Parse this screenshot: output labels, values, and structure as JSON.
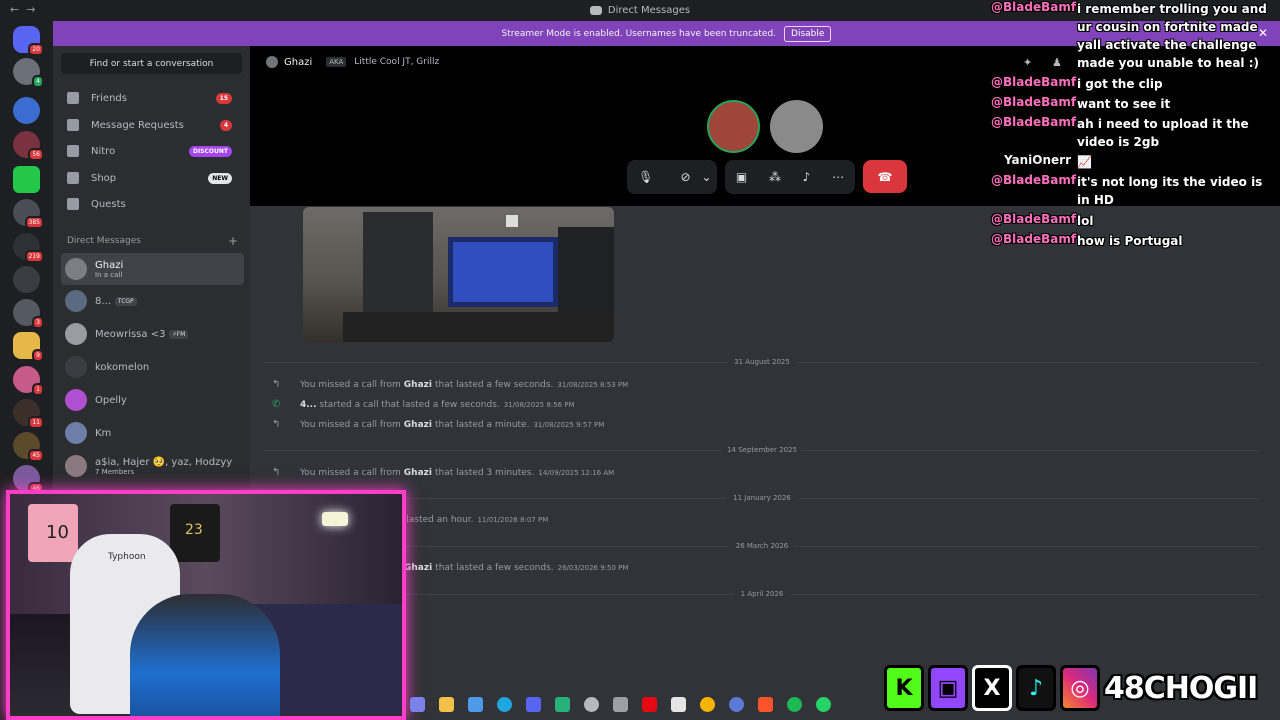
{
  "titlebar": {
    "title": "Direct Messages"
  },
  "banner": {
    "text": "Streamer Mode is enabled. Usernames have been truncated.",
    "disable_label": "Disable"
  },
  "guild_badges": [
    "20",
    "4",
    "56",
    "385",
    "219",
    "3",
    "9",
    "1",
    "11",
    "45",
    "46"
  ],
  "sidebar": {
    "search_placeholder": "Find or start a conversation",
    "nav": [
      {
        "label": "Friends",
        "badge": "15"
      },
      {
        "label": "Message Requests",
        "badge": "4"
      },
      {
        "label": "Nitro",
        "badge": "DISCOUNT"
      },
      {
        "label": "Shop",
        "badge": "NEW"
      },
      {
        "label": "Quests",
        "badge": ""
      }
    ],
    "dm_header": "Direct Messages",
    "dms": [
      {
        "name": "Ghazi",
        "sub": "In a call"
      },
      {
        "name": "8...",
        "tag": "TCGP"
      },
      {
        "name": "Meowrissa <3",
        "tag": "⚡FM"
      },
      {
        "name": "kokomelon"
      },
      {
        "name": "Opelly"
      },
      {
        "name": "Km"
      },
      {
        "name": "a$ia, Hajer 🥺, yaz, Hodzyy",
        "sub": "7 Members"
      }
    ]
  },
  "call": {
    "channel_name": "Ghazi",
    "aka": "AKA",
    "aka_names": "Little Cool JT, Grillz"
  },
  "chat": {
    "dates": [
      "31 August 2025",
      "14 September 2025",
      "11 January 2026",
      "26 March 2026",
      "1 April 2026"
    ],
    "messages": [
      {
        "pre": "You missed a call from",
        "who": "Ghazi",
        "post": "that lasted a few seconds.",
        "ts": "31/08/2025 8:53 PM"
      },
      {
        "pre": "",
        "who": "4...",
        "post": "started a call that lasted a few seconds.",
        "ts": "31/08/2025 8:56 PM"
      },
      {
        "pre": "You missed a call from",
        "who": "Ghazi",
        "post": "that lasted a minute.",
        "ts": "31/08/2025 9:57 PM"
      },
      {
        "pre": "You missed a call from",
        "who": "Ghazi",
        "post": "that lasted 3 minutes.",
        "ts": "14/09/2025 12:16 AM"
      },
      {
        "pre": "",
        "who": "",
        "post": "t lasted an hour.",
        "ts": "11/01/2026 8:07 PM"
      },
      {
        "pre": "",
        "who": "Ghazi",
        "post": "that lasted a few seconds.",
        "ts": "26/03/2026 9:50 PM"
      }
    ]
  },
  "stream_chat": [
    {
      "user": "@BladeBamf",
      "msg": "i remember trolling you and ur cousin on fortnite made yall activate the challenge made you unable to heal :)"
    },
    {
      "user": "@BladeBamf",
      "msg": "i got the clip"
    },
    {
      "user": "@BladeBamf",
      "msg": "want to see it"
    },
    {
      "user": "@BladeBamf",
      "msg": "ah i need to upload it the video is 2gb"
    },
    {
      "user": "YaniOnerr",
      "msg": "📈"
    },
    {
      "user": "@BladeBamf",
      "msg": "it's not long its the video is in HD"
    },
    {
      "user": "@BladeBamf",
      "msg": "lol"
    },
    {
      "user": "@BladeBamf",
      "msg": "how is Portugal"
    }
  ],
  "webcam": {
    "chair_brand": "Typhoon",
    "jersey_number": "10",
    "jersey_number_2": "23"
  },
  "socials": {
    "handle": "48CHOGII",
    "icons": [
      "kick-icon",
      "twitch-icon",
      "x-icon",
      "tiktok-icon",
      "instagram-icon"
    ]
  }
}
